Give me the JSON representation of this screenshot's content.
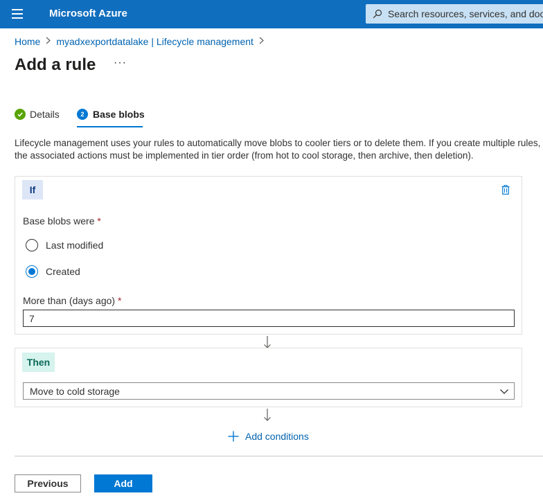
{
  "topbar": {
    "brand": "Microsoft Azure",
    "search_placeholder": "Search resources, services, and docs ("
  },
  "breadcrumb": {
    "items": [
      "Home",
      "myadxexportdatalake | Lifecycle management"
    ]
  },
  "page": {
    "title": "Add a rule",
    "more": "···"
  },
  "tabs": [
    {
      "label": "Details",
      "status": "complete"
    },
    {
      "label": "Base blobs",
      "number": "2",
      "status": "active"
    }
  ],
  "description": "Lifecycle management uses your rules to automatically move blobs to cooler tiers or to delete them. If you create multiple rules, the associated actions must be implemented in tier order (from hot to cool storage, then archive, then deletion).",
  "if_block": {
    "badge": "If",
    "base_blobs_label": "Base blobs were",
    "required_mark": "*",
    "options": [
      "Last modified",
      "Created"
    ],
    "selected_option": "Created",
    "days_label": "More than (days ago)",
    "days_value": "7"
  },
  "then_block": {
    "badge": "Then",
    "action_value": "Move to cold storage"
  },
  "add_conditions_label": "Add conditions",
  "footer": {
    "previous_label": "Previous",
    "add_label": "Add"
  },
  "colors": {
    "topbar": "#106ebe",
    "accent": "#0078d4",
    "success": "#57a300",
    "if_badge_bg": "#dde6f7",
    "then_badge_bg": "#d6f3ee"
  }
}
